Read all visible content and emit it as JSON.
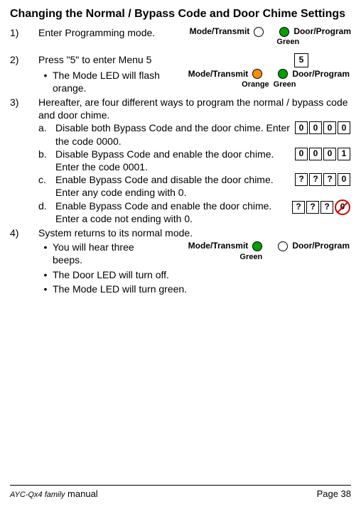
{
  "title": "Changing the Normal / Bypass Code and Door Chime Settings",
  "steps": {
    "s1": {
      "num": "1)",
      "text": "Enter Programming mode."
    },
    "s2": {
      "num": "2)",
      "text": "Press \"5\" to enter Menu 5",
      "bullet1": "The Mode LED will flash orange."
    },
    "s3": {
      "num": "3)",
      "text": "Hereafter, are four different ways to program the normal / bypass code and door chime.",
      "a": {
        "letter": "a.",
        "text": "Disable both Bypass Code and the door chime. Enter the code 0000."
      },
      "b": {
        "letter": "b.",
        "text": "Disable Bypass Code and enable the door chime. Enter the code 0001."
      },
      "c": {
        "letter": "c.",
        "text": "Enable Bypass Code and disable the door chime. Enter any code ending with 0."
      },
      "d": {
        "letter": "d.",
        "text": "Enable Bypass Code and enable the door chime.  Enter a code not ending with 0."
      }
    },
    "s4": {
      "num": "4)",
      "text": "System returns to its normal mode.",
      "bullet1": "You will hear three beeps.",
      "bullet2": "The Door LED will turn off.",
      "bullet3": "The Mode LED will turn green."
    }
  },
  "led": {
    "mode_transmit": "Mode/Transmit",
    "door_program": "Door/Program",
    "green": "Green",
    "orange": "Orange"
  },
  "keys": {
    "five": "5",
    "zero": "0",
    "one": "1",
    "q": "?"
  },
  "footer": {
    "left_prefix": "AYC-Qx4 family",
    "left_suffix": "manual",
    "right": "Page 38"
  }
}
